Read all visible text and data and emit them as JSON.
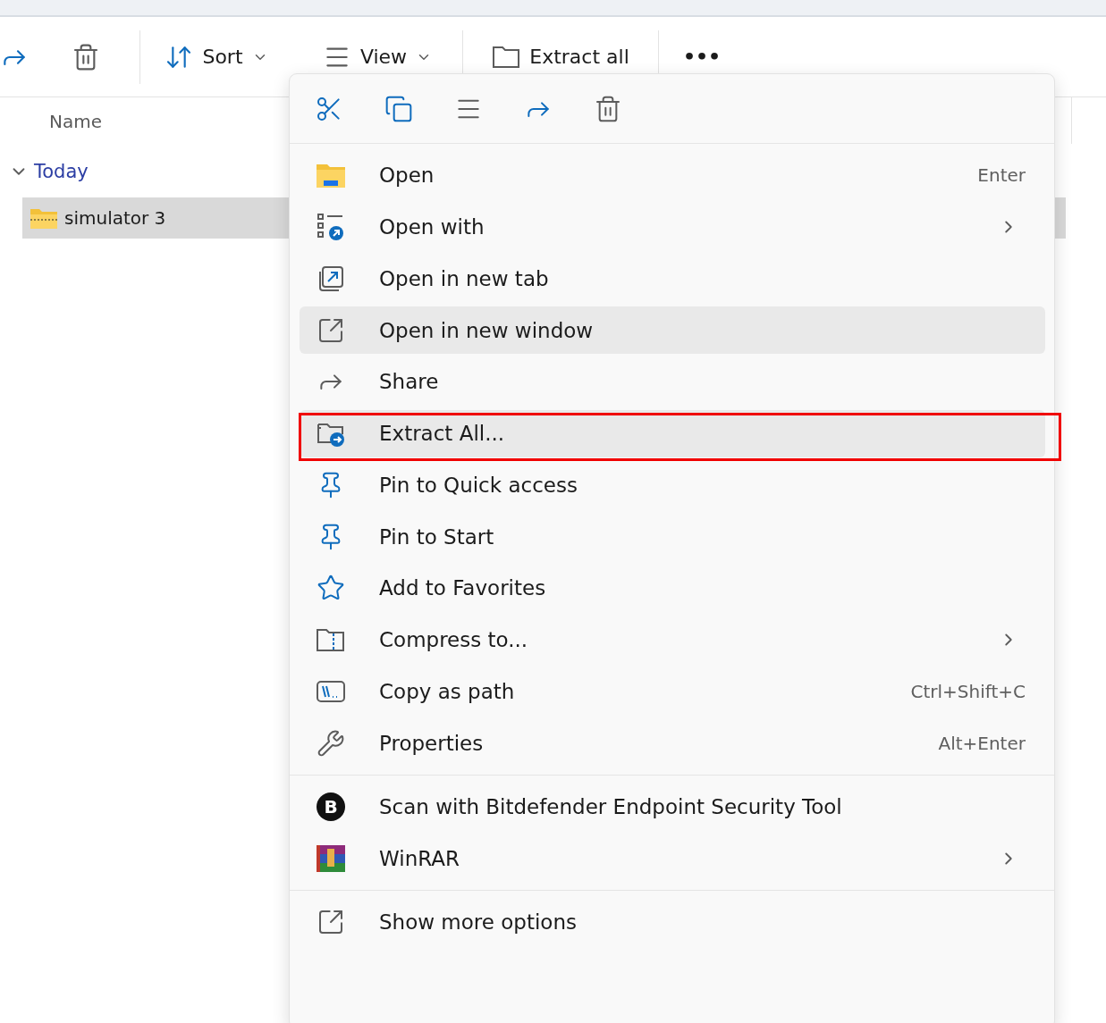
{
  "toolbar": {
    "items": [
      {
        "kind": "icon"
      },
      {
        "kind": "icon"
      },
      {
        "kind": "divider"
      },
      {
        "kind": "dropdown",
        "label": "Sort"
      },
      {
        "kind": "dropdown",
        "label": "View"
      },
      {
        "kind": "divider"
      },
      {
        "kind": "button",
        "label": "Extract all"
      },
      {
        "kind": "divider"
      },
      {
        "kind": "more",
        "label": "•••"
      }
    ]
  },
  "file_list": {
    "column": "Name",
    "group": {
      "label": "Today",
      "expanded": true
    },
    "rows": [
      {
        "name": "simulator 3",
        "selected": true
      }
    ]
  },
  "context_menu": {
    "sections": [
      [
        {
          "label": "Open",
          "shortcut": "Enter",
          "submenu": false,
          "hovered": false,
          "outlined": false
        },
        {
          "label": "Open with",
          "submenu": true,
          "hovered": false,
          "outlined": false
        },
        {
          "label": "Open in new tab",
          "submenu": false,
          "hovered": false,
          "outlined": false
        },
        {
          "label": "Open in new window",
          "submenu": false,
          "hovered": true,
          "outlined": false
        },
        {
          "label": "Share",
          "submenu": false,
          "hovered": false,
          "outlined": false
        },
        {
          "label": "Extract All...",
          "submenu": false,
          "hovered": true,
          "outlined": true
        },
        {
          "label": "Pin to Quick access",
          "submenu": false,
          "hovered": false,
          "outlined": false
        },
        {
          "label": "Pin to Start",
          "submenu": false,
          "hovered": false,
          "outlined": false
        },
        {
          "label": "Add to Favorites",
          "submenu": false,
          "hovered": false,
          "outlined": false
        },
        {
          "label": "Compress to...",
          "submenu": true,
          "hovered": false,
          "outlined": false
        },
        {
          "label": "Copy as path",
          "shortcut": "Ctrl+Shift+C",
          "submenu": false,
          "hovered": false,
          "outlined": false
        },
        {
          "label": "Properties",
          "shortcut": "Alt+Enter",
          "submenu": false,
          "hovered": false,
          "outlined": false
        }
      ],
      [
        {
          "label": "Scan with Bitdefender Endpoint Security Tool",
          "icon_text": "B",
          "submenu": false,
          "hovered": false,
          "outlined": false
        },
        {
          "label": "WinRAR",
          "submenu": true,
          "hovered": false,
          "outlined": false
        }
      ],
      [
        {
          "label": "Show more options",
          "submenu": false,
          "hovered": false,
          "outlined": false
        }
      ]
    ]
  }
}
